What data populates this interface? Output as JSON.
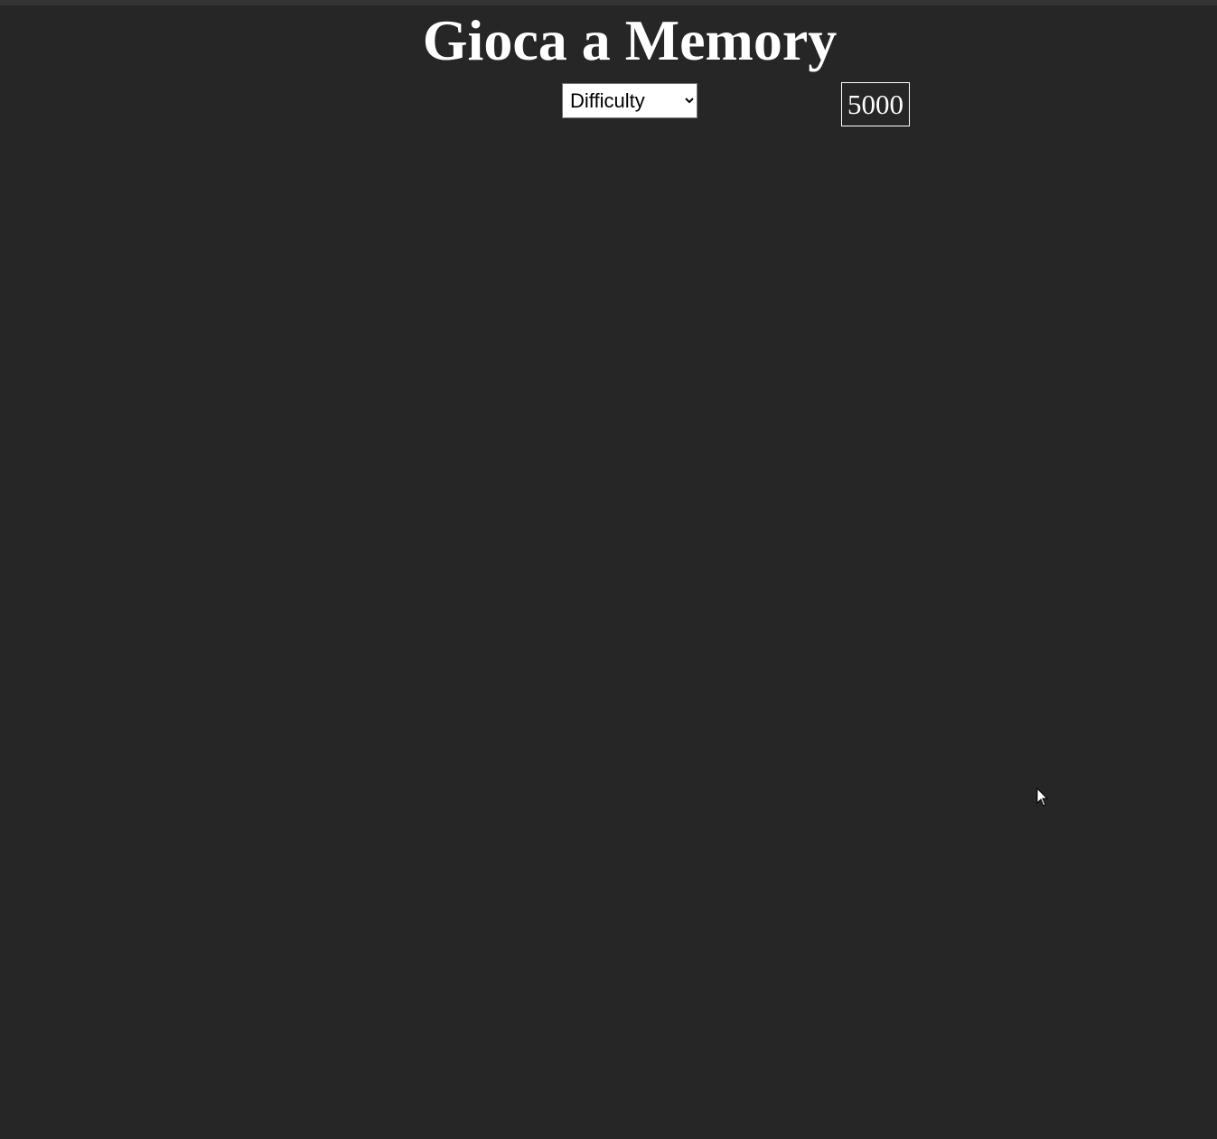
{
  "page": {
    "title": "Gioca a Memory",
    "background_color": "#262626"
  },
  "controls": {
    "difficulty": {
      "selected": "Difficulty"
    },
    "score": "5000"
  },
  "board": {
    "cards": []
  },
  "cursor": {
    "icon": "pointer-arrow-icon"
  }
}
